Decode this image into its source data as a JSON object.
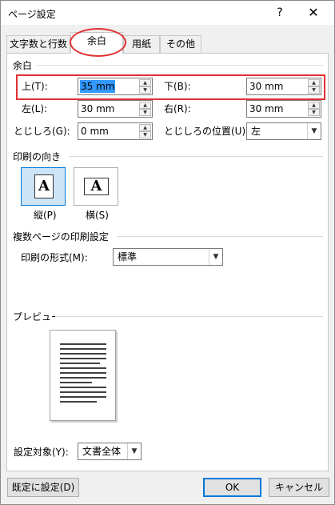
{
  "window": {
    "title": "ページ設定",
    "help_glyph": "?",
    "close_glyph": "✕"
  },
  "tabs": [
    {
      "label": "文字数と行数"
    },
    {
      "label": "余白"
    },
    {
      "label": "用紙"
    },
    {
      "label": "その他"
    }
  ],
  "margins": {
    "section_label": "余白",
    "top": {
      "label": "上(T):",
      "value": "35 mm"
    },
    "bottom": {
      "label": "下(B):",
      "value": "30 mm"
    },
    "left": {
      "label": "左(L):",
      "value": "30 mm"
    },
    "right": {
      "label": "右(R):",
      "value": "30 mm"
    },
    "gutter": {
      "label": "とじしろ(G):",
      "value": "0 mm"
    },
    "gutter_position": {
      "label": "とじしろの位置(U):",
      "value": "左"
    }
  },
  "orientation": {
    "section_label": "印刷の向き",
    "portrait": {
      "label": "縦(P)",
      "glyph": "A",
      "icon": "portrait-page-icon"
    },
    "landscape": {
      "label": "横(S)",
      "glyph": "A",
      "icon": "landscape-page-icon"
    }
  },
  "pages": {
    "section_label": "複数ページの印刷設定",
    "print_format_label": "印刷の形式(M):",
    "print_format_value": "標準"
  },
  "preview": {
    "section_label": "プレビュー",
    "icon": "page-preview-icon"
  },
  "apply_to": {
    "label": "設定対象(Y):",
    "value": "文書全体"
  },
  "buttons": {
    "default": "既定に設定(D)",
    "ok": "OK",
    "cancel": "キャンセル"
  },
  "colors": {
    "highlight": "#e03030",
    "selection": "#3399ff",
    "accent": "#0078d7"
  }
}
